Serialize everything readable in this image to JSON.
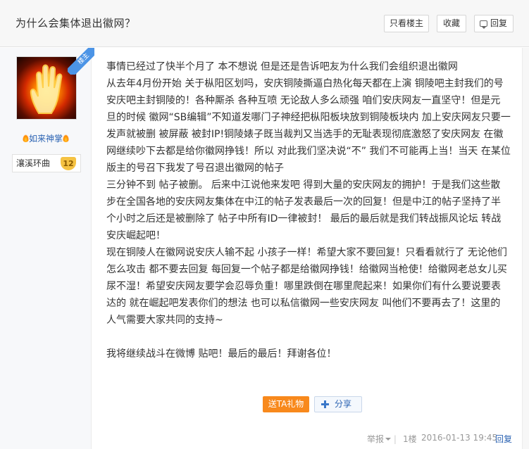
{
  "header": {
    "title": "为什么会集体退出徽网？",
    "btn_louzhu": "只看楼主",
    "btn_fav": "收藏",
    "btn_reply": "回复"
  },
  "author": {
    "name": "如来神掌",
    "badge_name": "瀼溪环曲",
    "badge_level": "12",
    "corner_tag": "楼主"
  },
  "post": {
    "lines": [
      "事情已经过了快半个月了 本不想说 但是还是告诉吧友为什么我们会组织退出徽网",
      "从去年4月份开始 关于枞阳区划吗，安庆铜陵撕逼白热化每天都在上演 铜陵吧主封我们的号",
      "安庆吧主封铜陵的！各种厮杀 各种互喷 无论敌人多么顽强 咱们安庆网友一直坚守！但是元",
      "旦的时候 徽网“SB编辑”不知道发哪门子神经把枞阳板块放到铜陵板块内 加上安庆网友只要一",
      "发声就被删 被屏蔽 被封IP!铜陵婊子既当裁判又当选手的无耻表现彻底激怒了安庆网友 在徽",
      "网继续吵下去都是给你徽网挣钱！所以 对此我们坚决说“不” 我们不可能再上当！当天 在某位",
      "版主的号召下我发了号召退出徽网的帖子",
      "三分钟不到 帖子被删。 后来中江说他来发吧 得到大量的安庆网友的拥护！于是我们这些散",
      "步在全国各地的安庆网友集体在中江的帖子发表最后一次的回复！但是中江的帖子坚持了半",
      "个小时之后还是被删除了 帖子中所有ID一律被封！ 最后的最后就是我们转战振风论坛 转战",
      "安庆崛起吧！",
      "现在铜陵人在徽网说安庆人输不起 小孩子一样！希望大家不要回复！只看看就行了 无论他们",
      "怎么攻击 都不要去回复 每回复一个帖子都是给徽网挣钱！给徽网当枪使！给徽网老总女儿买",
      "尿不湿！希望安庆网友要学会忍辱负重！哪里跌倒在哪里爬起来！如果你们有什么要说要表",
      "达的 就在崛起吧发表你们的想法 也可以私信徽网一些安庆网友 叫他们不要再去了！这里的",
      "人气需要大家共同的支持~"
    ],
    "closing": "我将继续战斗在微博 贴吧！最后的最后！拜谢各位！"
  },
  "actions": {
    "gift": "送TA礼物",
    "share": "分享"
  },
  "meta": {
    "report": "举报",
    "sep": "|",
    "floor": "1楼",
    "time": "2016-01-13 19:45",
    "reply": "回复"
  }
}
